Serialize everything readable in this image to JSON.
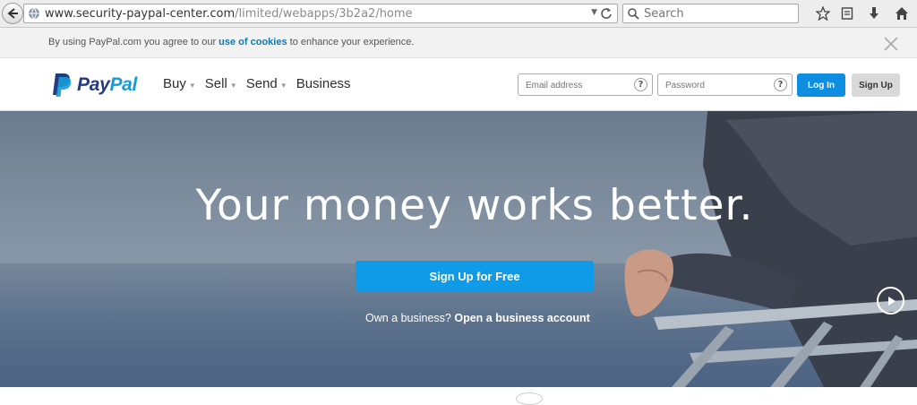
{
  "browser": {
    "url_host": "www.security-paypal-center.com",
    "url_path": "/limited/webapps/3b2a2/home",
    "search_placeholder": "Search"
  },
  "cookie_banner": {
    "prefix": "By using PayPal.com you agree to our ",
    "link": "use of cookies",
    "suffix": " to enhance your experience."
  },
  "header": {
    "logo_pay": "Pay",
    "logo_pal": "Pal",
    "nav": [
      {
        "label": "Buy"
      },
      {
        "label": "Sell"
      },
      {
        "label": "Send"
      },
      {
        "label": "Business"
      }
    ],
    "email_placeholder": "Email address",
    "password_placeholder": "Password",
    "help": "?",
    "login_label": "Log In",
    "signup_label": "Sign Up"
  },
  "hero": {
    "title": "Your money works better.",
    "cta_label": "Sign Up for Free",
    "sub_prefix": "Own a business? ",
    "sub_link": "Open a business account"
  },
  "colors": {
    "paypal_blue": "#0d8ee0",
    "paypal_navy": "#253b80",
    "paypal_light": "#179bd7"
  }
}
